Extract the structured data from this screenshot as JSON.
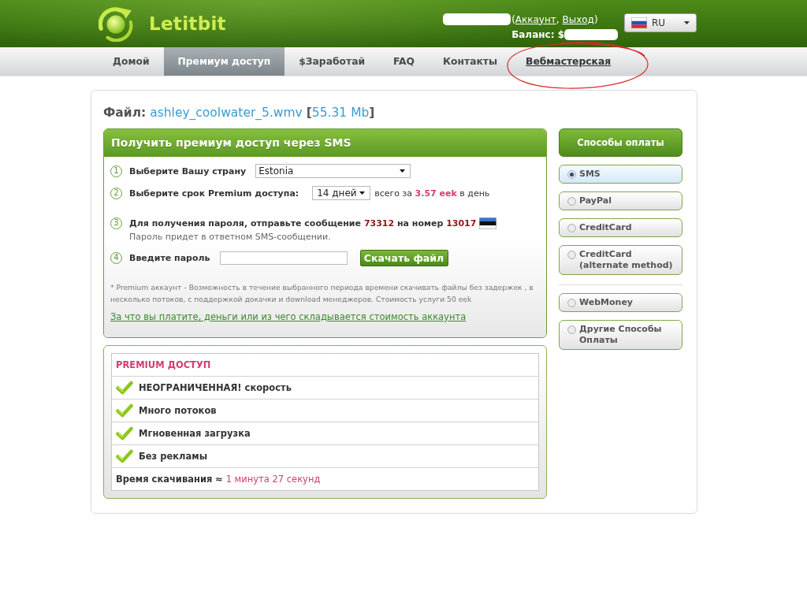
{
  "header": {
    "logo": "Letitbit",
    "account": {
      "open": "(",
      "account_link": "Аккаунт",
      "separator": ",",
      "logout_link": "Выход",
      "close": ")"
    },
    "balance_label": "Баланс: $",
    "language": "RU"
  },
  "nav": [
    {
      "label": "Домой",
      "selected": false,
      "hovered": false
    },
    {
      "label": "Премиум доступ",
      "selected": true,
      "hovered": false
    },
    {
      "label": "$Заработай",
      "selected": false,
      "hovered": false
    },
    {
      "label": "FAQ",
      "selected": false,
      "hovered": false
    },
    {
      "label": "Контакты",
      "selected": false,
      "hovered": false
    },
    {
      "label": "Вебмастерская",
      "selected": false,
      "hovered": true
    }
  ],
  "file": {
    "label": "Файл:",
    "name": "ashley_coolwater_5.wmv",
    "size_open": "[",
    "size": "55.31 Mb",
    "size_close": "]"
  },
  "sms_panel": {
    "title": "Получить премиум доступ через SMS",
    "steps": [
      {
        "kind": "select",
        "number": "1",
        "label": "Выберите Вашу страну",
        "value": "Estonia"
      },
      {
        "kind": "period",
        "number": "2",
        "label": "Выберите срок Premium доступа:",
        "value": "14 дней",
        "price_prefix": "всего за",
        "price": "3.57 eek",
        "price_suffix": "в день"
      },
      {
        "kind": "message",
        "number": "3",
        "message_prefix": "Для получения пароля, отправьте сообщение",
        "code": "73312",
        "number_prefix": "на номер",
        "phone": "13017",
        "hint": "Пароль придет в ответном SMS-сообщении."
      },
      {
        "kind": "password",
        "number": "4",
        "label": "Введите пароль",
        "button": "Скачать файл"
      }
    ],
    "note": "* Premium аккаунт - Возможность в течение выбранного периода времени скачивать файлы без задержек , в несколько потоков, с поддержкой докачки и download менеджеров. Стоимость услуги 50 eek",
    "link": "За что вы платите, деньги или из чего складывается стоимость аккаунта"
  },
  "premium_table": {
    "title": "PREMIUM ДОСТУП",
    "features": [
      "НЕОГРАНИЧЕННАЯ! скорость",
      "Много потоков",
      "Мгновенная загрузка",
      "Без рекламы"
    ],
    "time_label": "Время скачивания ≈",
    "time_value": "1 минута 27 секунд"
  },
  "payment_methods": {
    "title": "Способы оплаты",
    "groups": [
      {
        "items": [
          {
            "label": "SMS",
            "selected": true
          },
          {
            "label": "PayPal",
            "selected": false
          },
          {
            "label": "CreditCard",
            "selected": false
          },
          {
            "label": "CreditCard (alternate method)",
            "selected": false
          }
        ]
      },
      {
        "items": [
          {
            "label": "WebMoney",
            "selected": false
          },
          {
            "label": "Другие Способы Оплаты",
            "selected": false
          }
        ]
      }
    ]
  }
}
